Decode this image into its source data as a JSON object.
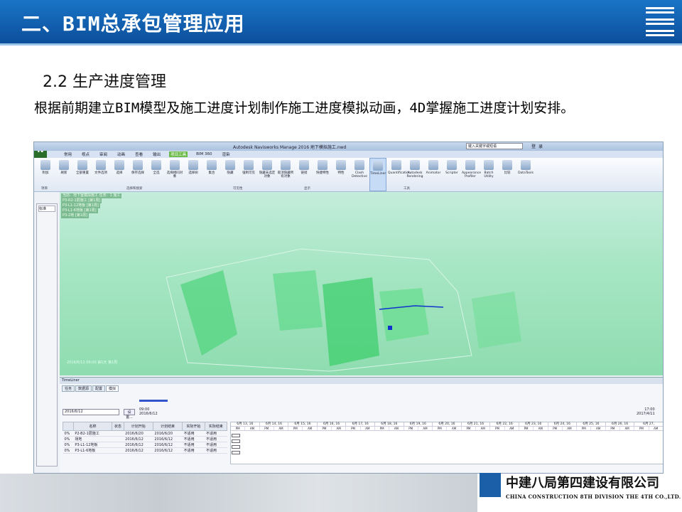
{
  "slide": {
    "header_title": "二、BIM总承包管理应用",
    "subtitle": "2.2 生产进度管理",
    "paragraph": "根据前期建立BIM模型及施工进度计划制作施工进度模拟动画，4D掌握施工进度计划安排。",
    "company_cn": "中建八局第四建设有限公司",
    "company_en": "CHINA CONSTRUCTION 8TH DIVISION THE 4TH CO.,LTD."
  },
  "app": {
    "title": "Autodesk Navisworks Manage 2016   地下模拟施工.nwd",
    "app_icon": "N",
    "search_placeholder": "键入关键字或短语",
    "user": "登录",
    "menus": [
      "常用",
      "视点",
      "审阅",
      "动画",
      "查看",
      "输出",
      "项目工具",
      "BIM 360",
      "渲染"
    ],
    "ribbon": [
      "附加",
      "刷新",
      "全部重置",
      "文件选项",
      "选择",
      "保存选择",
      "全选",
      "选择相同对象",
      "选择树",
      "集合",
      "隐藏",
      "强制可见",
      "隐藏未选定对象",
      "取消隐藏所有对象",
      "链接",
      "快捷特性",
      "特性",
      "Clash Detective",
      "TimeLiner",
      "Quantification",
      "Autodesk Rendering",
      "Animator",
      "Scripter",
      "Appearance Profiler",
      "Batch Utility",
      "比较",
      "DataTools"
    ],
    "groups": [
      "项目",
      "选择和搜索",
      "可见性",
      "显示",
      "工具"
    ],
    "sidebar_label": "标准",
    "viewport_info": [
      "当前：地下室模拟施工 任务：1 施工",
      "P3-R2-1层施工 [第1周]",
      "P3-L1-12地板 [第1周]",
      "P3-L1-6地板 [第1周]",
      "P3-2地 [第1周]"
    ],
    "viewport_stamp": "2016/6/12 09:00 第1天 第1周"
  },
  "timeliner": {
    "title": "TimeLiner",
    "tabs": [
      "任务",
      "数据源",
      "配置",
      "模拟"
    ],
    "date": "2016/6/12",
    "settings": "设置...",
    "start_time": "09:00",
    "start_date": "2016/6/12",
    "end_time": "17:00",
    "end_date": "2017/4/11",
    "columns": [
      "名称",
      "状态",
      "计划开始",
      "计划结束",
      "实际开始",
      "实际结束"
    ],
    "rows": [
      {
        "pct": "0%",
        "name": "P2-B2-1层施工",
        "ps": "2016/6/20",
        "pe": "2016/6/20",
        "as": "不适用",
        "ae": "不适用"
      },
      {
        "pct": "0%",
        "name": "场地",
        "ps": "2016/6/12",
        "pe": "2016/6/12",
        "as": "不适用",
        "ae": "不适用"
      },
      {
        "pct": "0%",
        "name": "P3-L1-12地板",
        "ps": "2016/6/12",
        "pe": "2016/6/12",
        "as": "不适用",
        "ae": "不适用"
      },
      {
        "pct": "0%",
        "name": "P3-L1-6地板",
        "ps": "2016/6/12",
        "pe": "2016/6/12",
        "as": "不适用",
        "ae": "不适用"
      }
    ],
    "days": [
      "6月 13, 16",
      "6月 14, 16",
      "6月 15, 16",
      "6月 16, 16",
      "6月 17, 16",
      "6月 18, 16",
      "6月 19, 16",
      "6月 20, 16",
      "6月 21, 16",
      "6月 22, 16",
      "6月 23, 16",
      "6月 24, 16",
      "6月 25, 16",
      "6月 26, 16",
      "6月 27,"
    ],
    "half": [
      "PM",
      "AM"
    ]
  }
}
